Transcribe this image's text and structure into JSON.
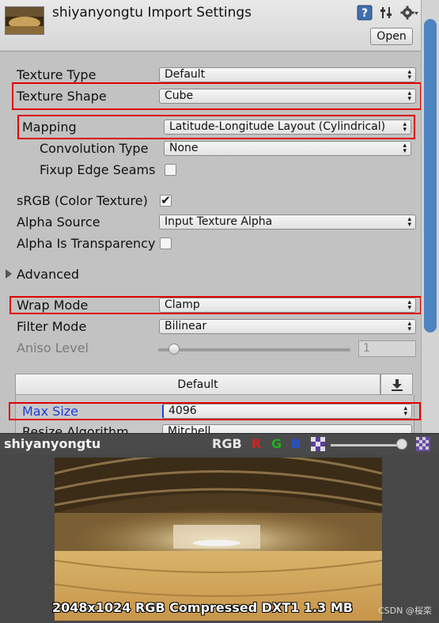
{
  "header": {
    "title": "shiyanyongtu Import Settings",
    "open_label": "Open",
    "icons": [
      "help-icon",
      "presets-icon",
      "settings-icon"
    ]
  },
  "fields": {
    "texture_type": {
      "label": "Texture Type",
      "value": "Default"
    },
    "texture_shape": {
      "label": "Texture Shape",
      "value": "Cube"
    },
    "mapping": {
      "label": "Mapping",
      "value": "Latitude-Longitude Layout (Cylindrical)"
    },
    "convolution_type": {
      "label": "Convolution Type",
      "value": "None"
    },
    "fixup_edge_seams": {
      "label": "Fixup Edge Seams",
      "checked": false
    },
    "srgb": {
      "label": "sRGB (Color Texture)",
      "checked": true
    },
    "alpha_source": {
      "label": "Alpha Source",
      "value": "Input Texture Alpha"
    },
    "alpha_is_transparency": {
      "label": "Alpha Is Transparency",
      "checked": false
    },
    "advanced": {
      "label": "Advanced"
    },
    "wrap_mode": {
      "label": "Wrap Mode",
      "value": "Clamp"
    },
    "filter_mode": {
      "label": "Filter Mode",
      "value": "Bilinear"
    },
    "aniso_level": {
      "label": "Aniso Level",
      "value": "1"
    }
  },
  "platform": {
    "tab_label": "Default",
    "max_size": {
      "label": "Max Size",
      "value": "4096"
    },
    "resize_algorithm": {
      "label": "Resize Algorithm",
      "value": "Mitchell"
    }
  },
  "preview": {
    "title": "shiyanyongtu",
    "channels": [
      "RGB",
      "R",
      "G",
      "B"
    ],
    "info": "2048x1024  RGB Compressed DXT1  1.3 MB",
    "watermark": "CSDN @桜栾"
  },
  "colors": {
    "highlight_box": "#e00000",
    "channel_r": "#d42020",
    "channel_g": "#20b020",
    "channel_b": "#2050e0",
    "accent_blue": "#1a3fd6"
  }
}
